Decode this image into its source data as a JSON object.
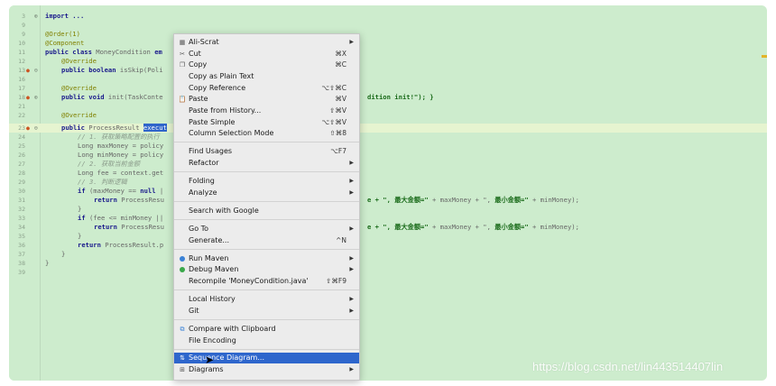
{
  "editor": {
    "line_numbers": [
      "3",
      "9",
      "9",
      "10",
      "11",
      "12",
      "13",
      "16",
      "17",
      "18",
      "21",
      "22",
      "23",
      "24",
      "25",
      "26",
      "27",
      "28",
      "29",
      "30",
      "31",
      "32",
      "33",
      "34",
      "35",
      "36",
      "37",
      "38",
      "39"
    ],
    "code": {
      "l3": "import ...",
      "l9a": "@Order(1)",
      "l10": "@Component",
      "l11a": "public class",
      "l11b": " MoneyCondition ",
      "l11c": "em",
      "l12": "@Override",
      "l13a": "public boolean",
      "l13b": " isSkip(Poli",
      "l17": "@Override",
      "l18a": "public void",
      "l18b": " init(TaskConte",
      "l18c": "dition init!\"); }",
      "l22": "@Override",
      "l23a": "public",
      "l23b": " ProcessResult ",
      "l23c": "execut",
      "l24": "// 1. 获取策略配置的执行",
      "l25": "Long maxMoney = policy",
      "l26": "Long minMoney = policy",
      "l27": "// 2. 获取当前金额",
      "l28": "Long fee = context.get",
      "l29": "// 3. 判断逻辑",
      "l30a": "if",
      "l30b": " (maxMoney == ",
      "l30c": "null",
      "l30d": " |",
      "l31a": "return",
      "l31b": " ProcessResu",
      "l31c": "e + \", ",
      "l31d": "最大金额=\"",
      "l31e": " + maxMoney + \", ",
      "l31f": "最小金额=\"",
      "l31g": " + minMoney);",
      "l32": "}",
      "l33a": "if",
      "l33b": " (fee <= minMoney ||",
      "l34a": "return",
      "l34b": " ProcessResu",
      "l34c": "e + \", ",
      "l34d": "最大金额=\"",
      "l34e": " + maxMoney + \", ",
      "l34f": "最小金额=\"",
      "l34g": " + minMoney);",
      "l35": "}",
      "l36a": "return",
      "l36b": " ProcessResult.",
      "l36c": "p",
      "l37": "}",
      "l38": "}"
    }
  },
  "context_menu": {
    "items": [
      {
        "icon": "ali-scrat-icon",
        "label": "Ali-Scrat",
        "shortcut": "",
        "submenu": true
      },
      {
        "icon": "scissors-icon",
        "label": "Cut",
        "shortcut": "⌘X",
        "submenu": false
      },
      {
        "icon": "copy-icon",
        "label": "Copy",
        "shortcut": "⌘C",
        "submenu": false
      },
      {
        "icon": "",
        "label": "Copy as Plain Text",
        "shortcut": "",
        "submenu": false
      },
      {
        "icon": "",
        "label": "Copy Reference",
        "shortcut": "⌥⇧⌘C",
        "submenu": false
      },
      {
        "icon": "paste-icon",
        "label": "Paste",
        "shortcut": "⌘V",
        "submenu": false
      },
      {
        "icon": "",
        "label": "Paste from History...",
        "shortcut": "⇧⌘V",
        "submenu": false
      },
      {
        "icon": "",
        "label": "Paste Simple",
        "shortcut": "⌥⇧⌘V",
        "submenu": false
      },
      {
        "icon": "",
        "label": "Column Selection Mode",
        "shortcut": "⇧⌘8",
        "submenu": false
      },
      {
        "icon": "",
        "label": "Find Usages",
        "shortcut": "⌥F7",
        "submenu": false
      },
      {
        "icon": "",
        "label": "Refactor",
        "shortcut": "",
        "submenu": true
      },
      {
        "icon": "",
        "label": "Folding",
        "shortcut": "",
        "submenu": true
      },
      {
        "icon": "",
        "label": "Analyze",
        "shortcut": "",
        "submenu": true
      },
      {
        "icon": "",
        "label": "Search with Google",
        "shortcut": "",
        "submenu": false
      },
      {
        "icon": "",
        "label": "Go To",
        "shortcut": "",
        "submenu": true
      },
      {
        "icon": "",
        "label": "Generate...",
        "shortcut": "^N",
        "submenu": false
      },
      {
        "icon": "run-maven-icon",
        "label": "Run Maven",
        "shortcut": "",
        "submenu": true
      },
      {
        "icon": "debug-maven-icon",
        "label": "Debug Maven",
        "shortcut": "",
        "submenu": true
      },
      {
        "icon": "",
        "label": "Recompile 'MoneyCondition.java'",
        "shortcut": "⇧⌘F9",
        "submenu": false
      },
      {
        "icon": "",
        "label": "Local History",
        "shortcut": "",
        "submenu": true
      },
      {
        "icon": "",
        "label": "Git",
        "shortcut": "",
        "submenu": true
      },
      {
        "icon": "compare-icon",
        "label": "Compare with Clipboard",
        "shortcut": "",
        "submenu": false
      },
      {
        "icon": "",
        "label": "File Encoding",
        "shortcut": "",
        "submenu": false
      },
      {
        "icon": "sequence-diagram-icon",
        "label": "Sequence Diagram...",
        "shortcut": "",
        "submenu": false
      },
      {
        "icon": "diagrams-icon",
        "label": "Diagrams",
        "shortcut": "",
        "submenu": true
      }
    ],
    "active_label": "Sequence Diagram..."
  },
  "watermark": "https://blog.csdn.net/lin443514407lin",
  "colors": {
    "editor_bg": "#cdeccd",
    "menu_bg": "#ececec",
    "menu_highlight": "#2e66cc",
    "keyword": "#1a1a8c",
    "annotation": "#808000"
  }
}
